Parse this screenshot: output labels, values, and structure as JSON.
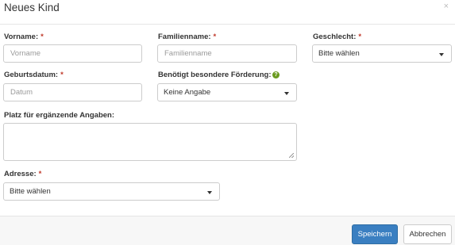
{
  "modal": {
    "title": "Neues Kind",
    "close_glyph": "×"
  },
  "form": {
    "required_marker": "*",
    "vorname": {
      "label": "Vorname:",
      "placeholder": "Vorname",
      "value": ""
    },
    "familienname": {
      "label": "Familienname:",
      "placeholder": "Familienname",
      "value": ""
    },
    "geschlecht": {
      "label": "Geschlecht:",
      "selected": "Bitte wählen"
    },
    "geburtsdatum": {
      "label": "Geburtsdatum:",
      "placeholder": "Datum",
      "value": ""
    },
    "foerderung": {
      "label": "Benötigt besondere Förderung:",
      "selected": "Keine Angabe",
      "help_glyph": "?"
    },
    "angaben": {
      "label": "Platz für ergänzende Angaben:",
      "value": ""
    },
    "adresse": {
      "label": "Adresse:",
      "selected": "Bitte wählen"
    }
  },
  "footer": {
    "save_label": "Speichern",
    "cancel_label": "Abbrechen"
  },
  "colors": {
    "primary": "#3a7fc1",
    "required": "#c0392b",
    "help": "#6a9a1f"
  }
}
